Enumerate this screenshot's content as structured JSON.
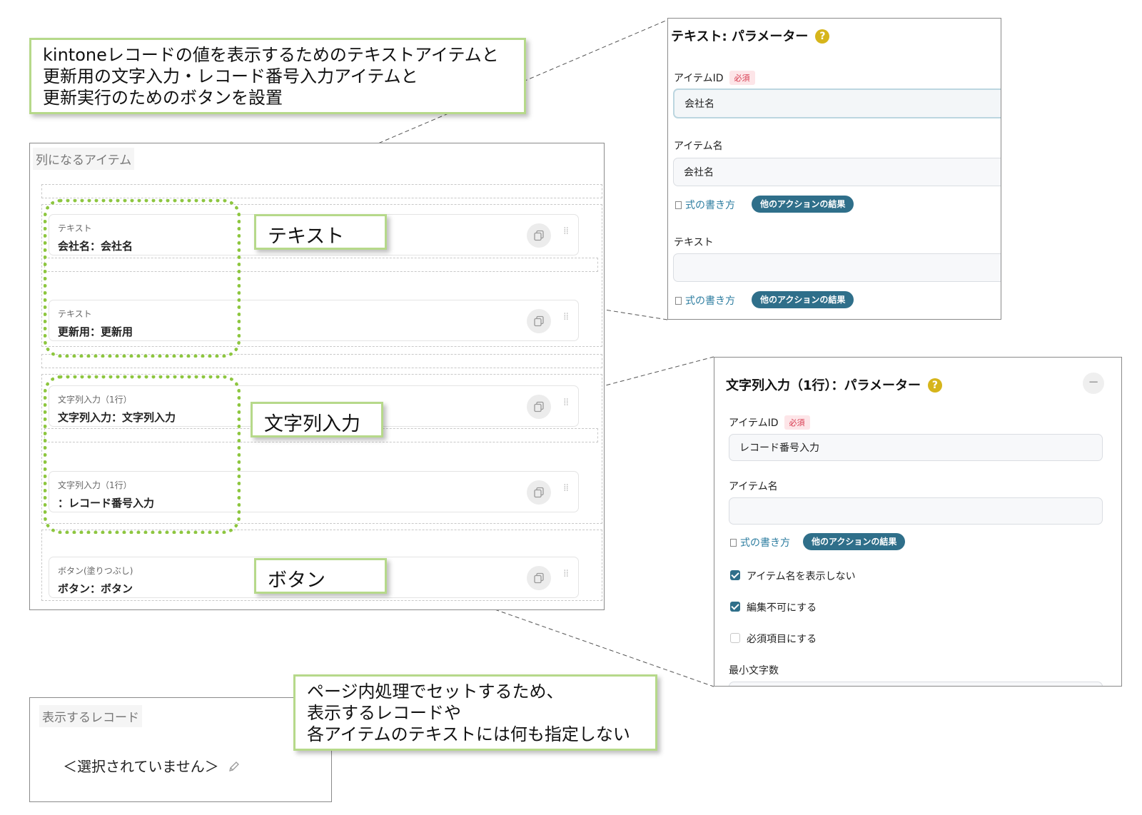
{
  "callouts": {
    "top": [
      "kintoneレコードの値を表示するためのテキストアイテムと",
      "更新用の文字入力・レコード番号入力アイテムと",
      "更新実行のためのボタンを設置"
    ],
    "text_tag": "テキスト",
    "string_input_tag": "文字列入力",
    "button_tag": "ボタン",
    "bottom": [
      "ページ内処理でセットするため、",
      "表示するレコードや",
      "各アイテムのテキストには何も指定しない"
    ]
  },
  "column_items": {
    "label": "列になるアイテム",
    "items": [
      {
        "type": "テキスト",
        "value": "会社名：会社名"
      },
      {
        "type": "テキスト",
        "value": "更新用：更新用"
      },
      {
        "type": "文字列入力（1行）",
        "value": "文字列入力：文字列入力"
      },
      {
        "type": "文字列入力（1行）",
        "value": "：レコード番号入力"
      },
      {
        "type": "ボタン(塗りつぶし)",
        "value": "ボタン：ボタン"
      }
    ]
  },
  "text_params": {
    "title": "テキスト: パラメーター",
    "help": "?",
    "item_id_label": "アイテムID",
    "required_badge": "必須",
    "item_id_value": "会社名",
    "item_name_label": "アイテム名",
    "item_name_value": "会社名",
    "formula_link": "式の書き方",
    "action_result_button": "他のアクションの結果",
    "text_label": "テキスト",
    "text_value": ""
  },
  "string_params": {
    "title": "文字列入力（1行）：パラメーター",
    "help": "?",
    "collapse": "−",
    "item_id_label": "アイテムID",
    "required_badge": "必須",
    "item_id_value": "レコード番号入力",
    "item_name_label": "アイテム名",
    "item_name_value": "",
    "formula_link": "式の書き方",
    "action_result_button": "他のアクションの結果",
    "checkboxes": [
      {
        "label": "アイテム名を表示しない",
        "checked": true
      },
      {
        "label": "編集不可にする",
        "checked": true
      },
      {
        "label": "必須項目にする",
        "checked": false
      }
    ],
    "min_length_label": "最小文字数"
  },
  "record": {
    "label": "表示するレコード",
    "value": "＜選択されていません＞",
    "edit_icon": "pencil-icon"
  }
}
